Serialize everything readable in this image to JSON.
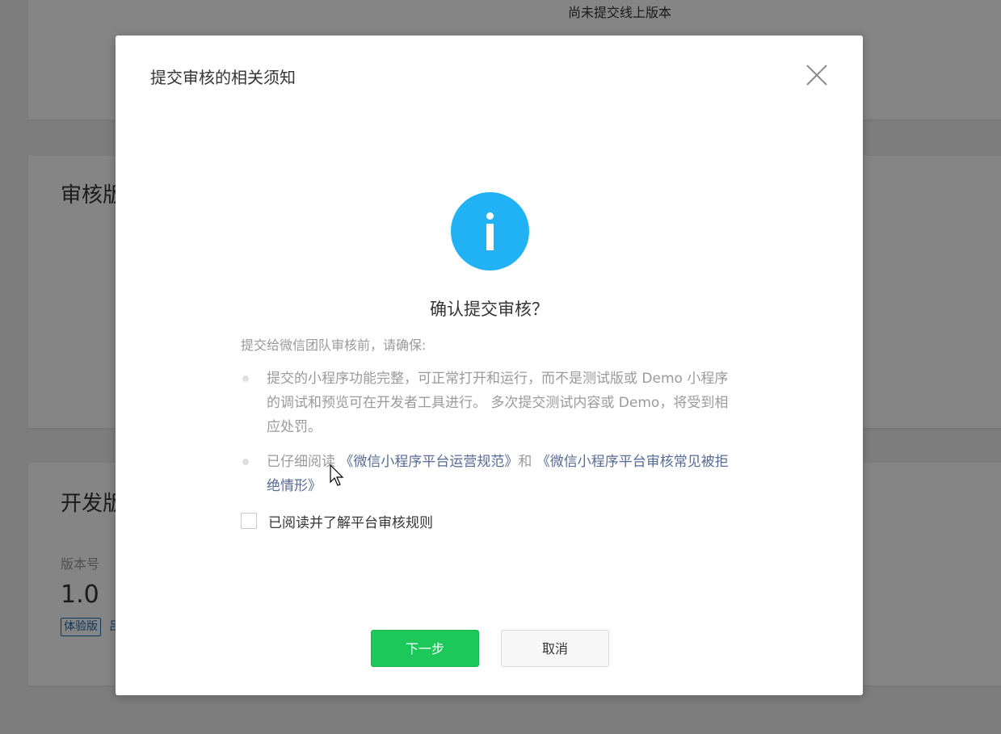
{
  "background": {
    "online_status": "尚未提交线上版本",
    "review_section_title": "审核版",
    "dev_section_title": "开发版",
    "version_label": "版本号",
    "version_value": "1.0",
    "badge_label": "体验版",
    "badge_extra": "吕"
  },
  "dialog": {
    "title": "提交审核的相关须知",
    "icon": "info-icon",
    "confirm_heading": "确认提交审核？",
    "intro": "提交给微信团队审核前，请确保:",
    "notice_1": "提交的小程序功能完整，可正常打开和运行，而不是测试版或 Demo 小程序的调试和预览可在开发者工具进行。 多次提交测试内容或 Demo，将受到相应处罚。",
    "notice_2_prefix": "已仔细阅读 ",
    "notice_2_link_1": "《微信小程序平台运营规范》",
    "notice_2_and": "和 ",
    "notice_2_link_2": "《微信小程序平台审核常见被拒绝情形》",
    "agree_label": "已阅读并了解平台审核规则",
    "next_button": "下一步",
    "cancel_button": "取消"
  },
  "colors": {
    "accent_green": "#1cc85a",
    "info_blue": "#20b2f4",
    "link": "#576b95"
  }
}
